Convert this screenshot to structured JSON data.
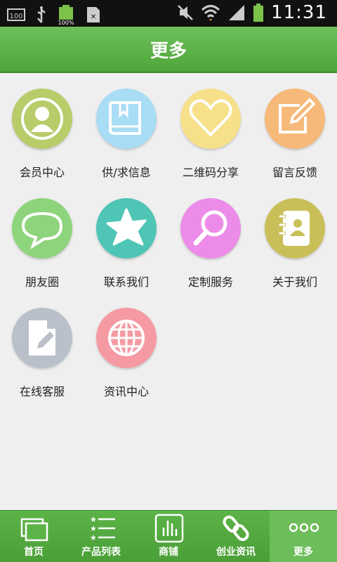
{
  "status_bar": {
    "time": "11:31",
    "battery_label": "100%",
    "left_icons": [
      "storage-100-icon",
      "usb-icon",
      "battery-full-icon",
      "sim-icon"
    ],
    "right_icons": [
      "mute-icon",
      "wifi-icon",
      "signal-icon",
      "battery-icon"
    ]
  },
  "header": {
    "title": "更多"
  },
  "grid": {
    "items": [
      {
        "label": "会员中心",
        "icon": "member-icon",
        "color": "#b8cc6a"
      },
      {
        "label": "供/求信息",
        "icon": "book-icon",
        "color": "#a9dcf5"
      },
      {
        "label": "二维码分享",
        "icon": "heart-icon",
        "color": "#f7e08a"
      },
      {
        "label": "留言反馈",
        "icon": "edit-icon",
        "color": "#f6b97a"
      },
      {
        "label": "朋友圈",
        "icon": "chat-bubble-icon",
        "color": "#8ed47c"
      },
      {
        "label": "联系我们",
        "icon": "star-icon",
        "color": "#4fc5b6"
      },
      {
        "label": "定制服务",
        "icon": "magnifier-icon",
        "color": "#ec8ce8"
      },
      {
        "label": "关于我们",
        "icon": "contact-book-icon",
        "color": "#c9bf58"
      },
      {
        "label": "在线客服",
        "icon": "document-edit-icon",
        "color": "#b9c0ca"
      },
      {
        "label": "资讯中心",
        "icon": "globe-icon",
        "color": "#f59aa3"
      }
    ]
  },
  "bottom_nav": {
    "items": [
      {
        "label": "首页",
        "icon": "home-windows-icon",
        "active": false
      },
      {
        "label": "产品列表",
        "icon": "list-icon",
        "active": false
      },
      {
        "label": "商铺",
        "icon": "shop-chart-icon",
        "active": false
      },
      {
        "label": "创业资讯",
        "icon": "link-icon",
        "active": false
      },
      {
        "label": "更多",
        "icon": "more-dots-icon",
        "active": true
      }
    ]
  }
}
